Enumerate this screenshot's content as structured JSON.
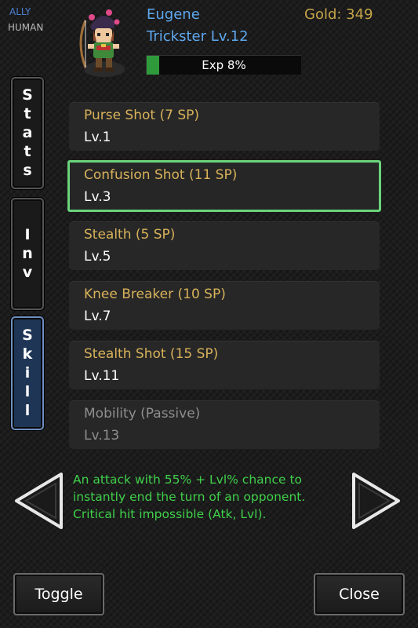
{
  "header": {
    "faction": "ALLY",
    "race": "HUMAN",
    "name": "Eugene",
    "class_level": "Trickster Lv.12",
    "gold": "Gold: 349",
    "exp_text": "Exp 8%",
    "exp_fraction": 0.08
  },
  "tabs": [
    {
      "label": "Stats",
      "letters": [
        "S",
        "t",
        "a",
        "t",
        "s"
      ],
      "active": false
    },
    {
      "label": "Inv",
      "letters": [
        "I",
        "n",
        "v"
      ],
      "active": false
    },
    {
      "label": "Skill",
      "letters": [
        "S",
        "k",
        "i",
        "l",
        "l"
      ],
      "active": true
    }
  ],
  "skills": [
    {
      "name": "Purse Shot (7 SP)",
      "level": "Lv.1"
    },
    {
      "name": "Confusion Shot (11 SP)",
      "level": "Lv.3",
      "selected": true
    },
    {
      "name": "Stealth (5 SP)",
      "level": "Lv.5"
    },
    {
      "name": "Knee Breaker (10 SP)",
      "level": "Lv.7"
    },
    {
      "name": "Stealth Shot (15 SP)",
      "level": "Lv.11"
    },
    {
      "name": "Mobility (Passive)",
      "level": "Lv.13",
      "passive": true
    }
  ],
  "description": [
    "An attack with 55% + Lvl% chance to",
    "instantly end the turn of an opponent.",
    "Critical hit impossible (Atk, Lvl)."
  ],
  "buttons": {
    "toggle": "Toggle",
    "close": "Close"
  },
  "colors": {
    "selected_border": "#69d47b",
    "skill_name": "#d8b25a",
    "description": "#3fd04a",
    "name_blue": "#5ea8ee",
    "gold": "#c5a448",
    "exp_fill": "#2f9a3c"
  }
}
